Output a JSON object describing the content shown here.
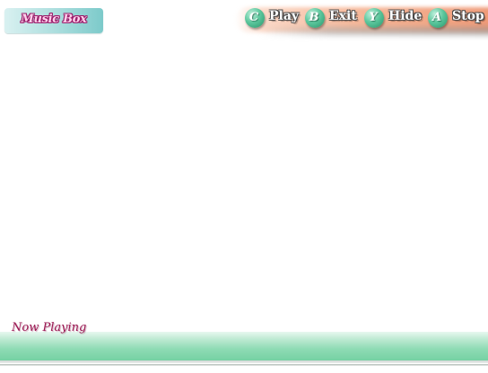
{
  "title": "Music Box",
  "buttons": [
    {
      "key": "C",
      "label": "Play"
    },
    {
      "key": "B",
      "label": "Exit"
    },
    {
      "key": "Y",
      "label": "Hide"
    },
    {
      "key": "A",
      "label": "Stop"
    }
  ],
  "footer": {
    "now_playing_label": "Now Playing",
    "now_playing_track": ""
  },
  "colors": {
    "title_text": "#ffd0ec",
    "title_outline": "#9a1d6a",
    "button_circle": "#3fb383",
    "button_bar": "#f2a47f",
    "now_playing_text": "#9a1550",
    "footer_bar": "#8edbb4"
  }
}
